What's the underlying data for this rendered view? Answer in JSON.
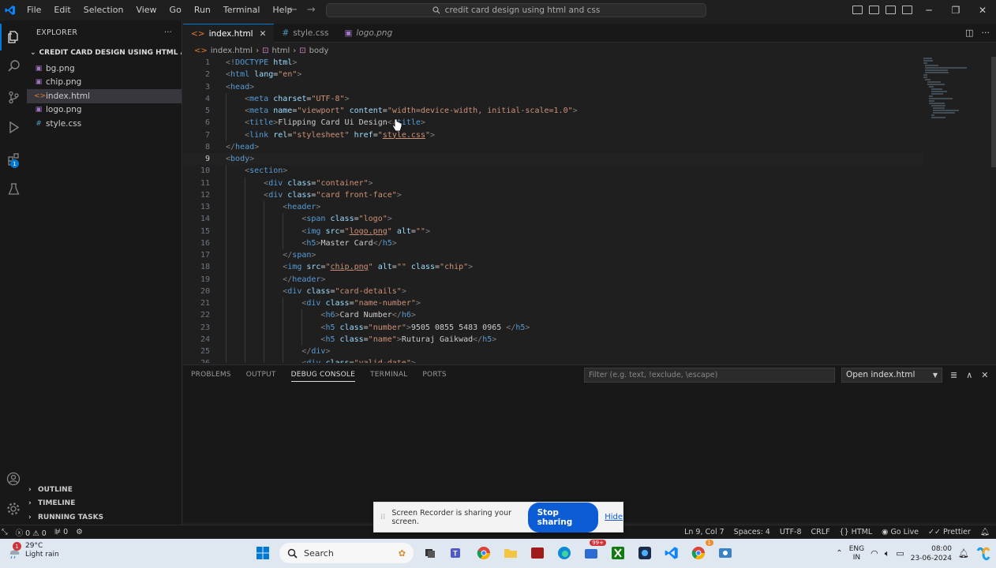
{
  "menu": [
    "File",
    "Edit",
    "Selection",
    "View",
    "Go",
    "Run",
    "Terminal",
    "Help"
  ],
  "command_center": "credit card design using html and css",
  "sidebar": {
    "title": "EXPLORER",
    "more": "···",
    "folder": "CREDIT CARD DESIGN USING HTML AND ...",
    "files": [
      {
        "name": "bg.png",
        "icon": "image-file-icon"
      },
      {
        "name": "chip.png",
        "icon": "image-file-icon"
      },
      {
        "name": "index.html",
        "icon": "html-file-icon"
      },
      {
        "name": "logo.png",
        "icon": "image-file-icon"
      },
      {
        "name": "style.css",
        "icon": "css-file-icon"
      }
    ],
    "activity_badge": "1",
    "sections": [
      "OUTLINE",
      "TIMELINE",
      "RUNNING TASKS"
    ]
  },
  "tabs": [
    {
      "label": "index.html",
      "close": "✕"
    },
    {
      "label": "style.css"
    },
    {
      "label": "logo.png"
    }
  ],
  "breadcrumb": [
    "index.html",
    "html",
    "body"
  ],
  "editor": {
    "current_line": 9,
    "lines": [
      {
        "n": "1",
        "text": "<!DOCTYPE html>"
      },
      {
        "n": "2",
        "text": "<html lang=\"en\">"
      },
      {
        "n": "3",
        "text": "<head>"
      },
      {
        "n": "4",
        "text": "    <meta charset=\"UTF-8\">"
      },
      {
        "n": "5",
        "text": "    <meta name=\"viewport\" content=\"width=device-width, initial-scale=1.0\">"
      },
      {
        "n": "6",
        "text": "    <title>Flipping Card Ui Design</title>"
      },
      {
        "n": "7",
        "text": "    <link rel=\"stylesheet\" href=\"style.css\">"
      },
      {
        "n": "8",
        "text": "</head>"
      },
      {
        "n": "9",
        "text": "<body>"
      },
      {
        "n": "10",
        "text": "    <section>"
      },
      {
        "n": "11",
        "text": "        <div class=\"container\">"
      },
      {
        "n": "12",
        "text": "        <div class=\"card front-face\">"
      },
      {
        "n": "13",
        "text": "            <header>"
      },
      {
        "n": "14",
        "text": "                <span class=\"logo\">"
      },
      {
        "n": "15",
        "text": "                <img src=\"logo.png\" alt=\"\">"
      },
      {
        "n": "16",
        "text": "                <h5>Master Card</h5>"
      },
      {
        "n": "17",
        "text": "            </span>"
      },
      {
        "n": "18",
        "text": "            <img src=\"chip.png\" alt=\"\" class=\"chip\">"
      },
      {
        "n": "19",
        "text": "            </header>"
      },
      {
        "n": "20",
        "text": "            <div class=\"card-details\">"
      },
      {
        "n": "21",
        "text": "                <div class=\"name-number\">"
      },
      {
        "n": "22",
        "text": "                    <h6>Card Number</h6>"
      },
      {
        "n": "23",
        "text": "                    <h5 class=\"number\">9505 0855 5483 0965 </h5>"
      },
      {
        "n": "24",
        "text": "                    <h5 class=\"name\">Ruturaj Gaikwad</h5>"
      },
      {
        "n": "25",
        "text": "                </div>"
      },
      {
        "n": "26",
        "text": "                <div class=\"valid-date\">"
      }
    ]
  },
  "panel": {
    "tabs": [
      "PROBLEMS",
      "OUTPUT",
      "DEBUG CONSOLE",
      "TERMINAL",
      "PORTS"
    ],
    "active_tab": "DEBUG CONSOLE",
    "filter_placeholder": "Filter (e.g. text, !exclude, \\escape)",
    "open_select": "Open index.html"
  },
  "statusbar": {
    "errors": "0",
    "warnings": "0",
    "ports": "0",
    "position": "Ln 9, Col 7",
    "spaces": "Spaces: 4",
    "encoding": "UTF-8",
    "eol": "CRLF",
    "language": "HTML",
    "golive": "Go Live",
    "prettier": "Prettier"
  },
  "share": {
    "message": "Screen Recorder is sharing your screen.",
    "stop": "Stop sharing",
    "hide": "Hide"
  },
  "taskbar": {
    "temp": "29°C",
    "weather": "Light rain",
    "weather_badge": "1",
    "search": "Search",
    "lang_top": "ENG",
    "lang_bottom": "IN",
    "time": "08:00",
    "date": "23-06-2024",
    "badge": "99+",
    "chrome_badge": "1"
  },
  "colors": {
    "accent": "#0078d4",
    "editor_bg": "#1f1f1f",
    "sidebar_bg": "#181818",
    "tag": "#569cd6",
    "attr": "#9cdcfe",
    "string": "#ce9178",
    "taskbar_bg": "#dfe7f0"
  }
}
